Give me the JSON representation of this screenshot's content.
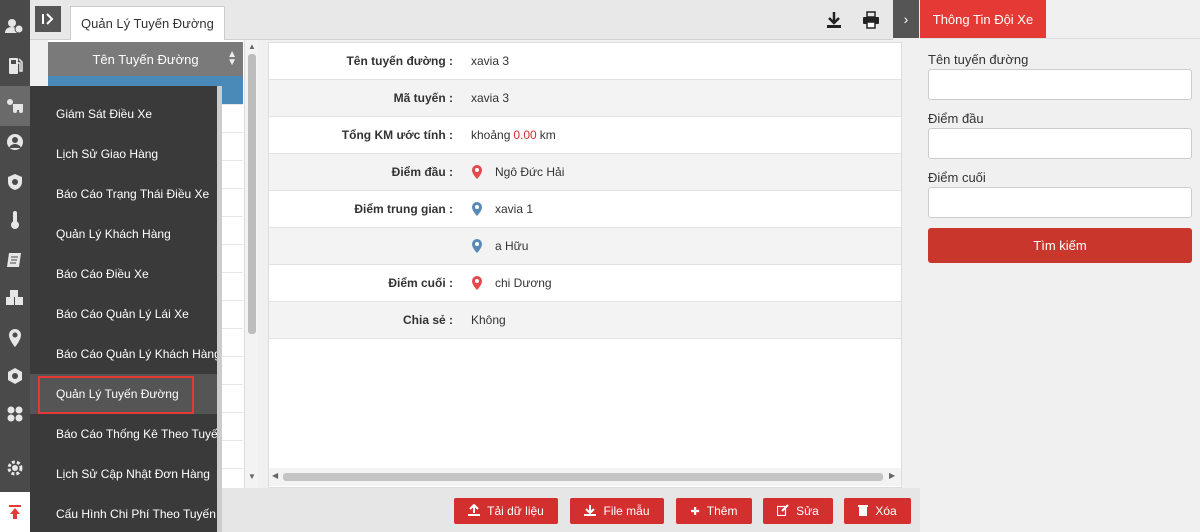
{
  "topbar": {
    "tab_label": "Quản Lý Tuyến Đường",
    "icons": [
      "collapse-sidebar-icon",
      "download-icon",
      "print-icon"
    ]
  },
  "list": {
    "header": "Tên Tuyến Đường",
    "sort_icon": "sort-icon"
  },
  "menu": {
    "items": [
      "Giám Sát Điều Xe",
      "Lịch Sử Giao Hàng",
      "Báo Cáo Trạng Thái Điều Xe",
      "Quản Lý Khách Hàng",
      "Báo Cáo Điều Xe",
      "Báo Cáo Quản Lý Lái Xe",
      "Báo Cáo Quản Lý Khách Hàng",
      "Quản Lý Tuyến Đường",
      "Báo Cáo Thống Kê Theo Tuyến",
      "Lịch Sử Cập Nhật Đơn Hàng",
      "Cấu Hình Chi Phí Theo Tuyến"
    ],
    "highlighted_index": 7
  },
  "rail_icons": [
    "user-group-icon",
    "fuel-icon",
    "dispatch-icon",
    "user-circle-icon",
    "shield-icon",
    "temperature-icon",
    "report-icon",
    "boxes-icon",
    "map-pin-icon",
    "hexagon-icon",
    "grid-icon",
    "settings-icon",
    "scroll-top-icon"
  ],
  "detail": {
    "route_name_label": "Tên tuyến đường :",
    "route_name": "xavia 3",
    "route_code_label": "Mã tuyến :",
    "route_code": "xavia 3",
    "km_label": "Tổng KM ước tính :",
    "km_prefix": "khoảng",
    "km_value": "0.00",
    "km_unit": "km",
    "start_label": "Điểm đầu :",
    "start_value": "Ngô Đức Hải",
    "mid_label": "Điểm trung gian :",
    "mid_values": [
      "xavia 1",
      "a Hữu"
    ],
    "end_label": "Điểm cuối :",
    "end_value": "chi Dương",
    "share_label": "Chia sẻ :",
    "share_value": "Không"
  },
  "actions": {
    "upload": "Tải dữ liệu",
    "template": "File mẫu",
    "add": "Thêm",
    "edit": "Sửa",
    "delete": "Xóa"
  },
  "right_panel": {
    "tab": "Thông Tin Đội Xe",
    "route_name_label": "Tên tuyến đường",
    "route_name_value": "",
    "start_label": "Điểm đầu",
    "start_value": "",
    "end_label": "Điểm cuối",
    "end_value": "",
    "search_button": "Tìm kiếm"
  },
  "colors": {
    "accent_red": "#e53935",
    "pin_red": "#e5484d",
    "pin_blue": "#5a8ab8",
    "menu_bg": "#3a3a3a",
    "selected_row": "#4a8ab8"
  }
}
